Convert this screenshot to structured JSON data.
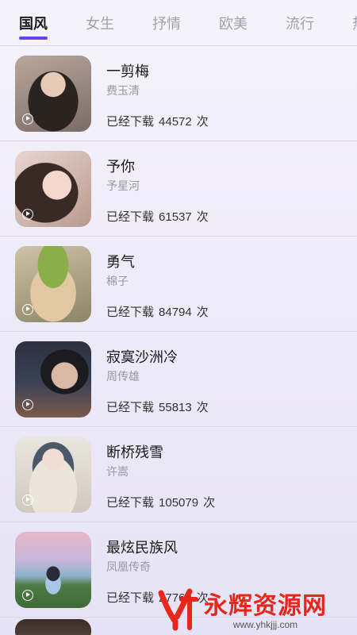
{
  "tabs": [
    {
      "label": "国风",
      "active": true
    },
    {
      "label": "女生"
    },
    {
      "label": "抒情"
    },
    {
      "label": "欧美"
    },
    {
      "label": "流行"
    },
    {
      "label": "热"
    }
  ],
  "songs": [
    {
      "title": "一剪梅",
      "artist": "费玉清",
      "prefix": "已经下载",
      "count": "44572",
      "suffix": "次"
    },
    {
      "title": "予你",
      "artist": "予星河",
      "prefix": "已经下载",
      "count": "61537",
      "suffix": "次"
    },
    {
      "title": "勇气",
      "artist": "棉子",
      "prefix": "已经下载",
      "count": "84794",
      "suffix": "次"
    },
    {
      "title": "寂寞沙洲冷",
      "artist": "周传雄",
      "prefix": "已经下载",
      "count": "55813",
      "suffix": "次"
    },
    {
      "title": "断桥残雪",
      "artist": "许嵩",
      "prefix": "已经下载",
      "count": "105079",
      "suffix": "次"
    },
    {
      "title": "最炫民族风",
      "artist": "凤凰传奇",
      "prefix": "已经下载",
      "count": "27762",
      "suffix": "次"
    }
  ],
  "watermark": {
    "title": "永辉资源网",
    "url": "www.yhkjjj.com"
  },
  "colors": {
    "accent": "#6b3ff0",
    "watermark": "#e8261a"
  }
}
